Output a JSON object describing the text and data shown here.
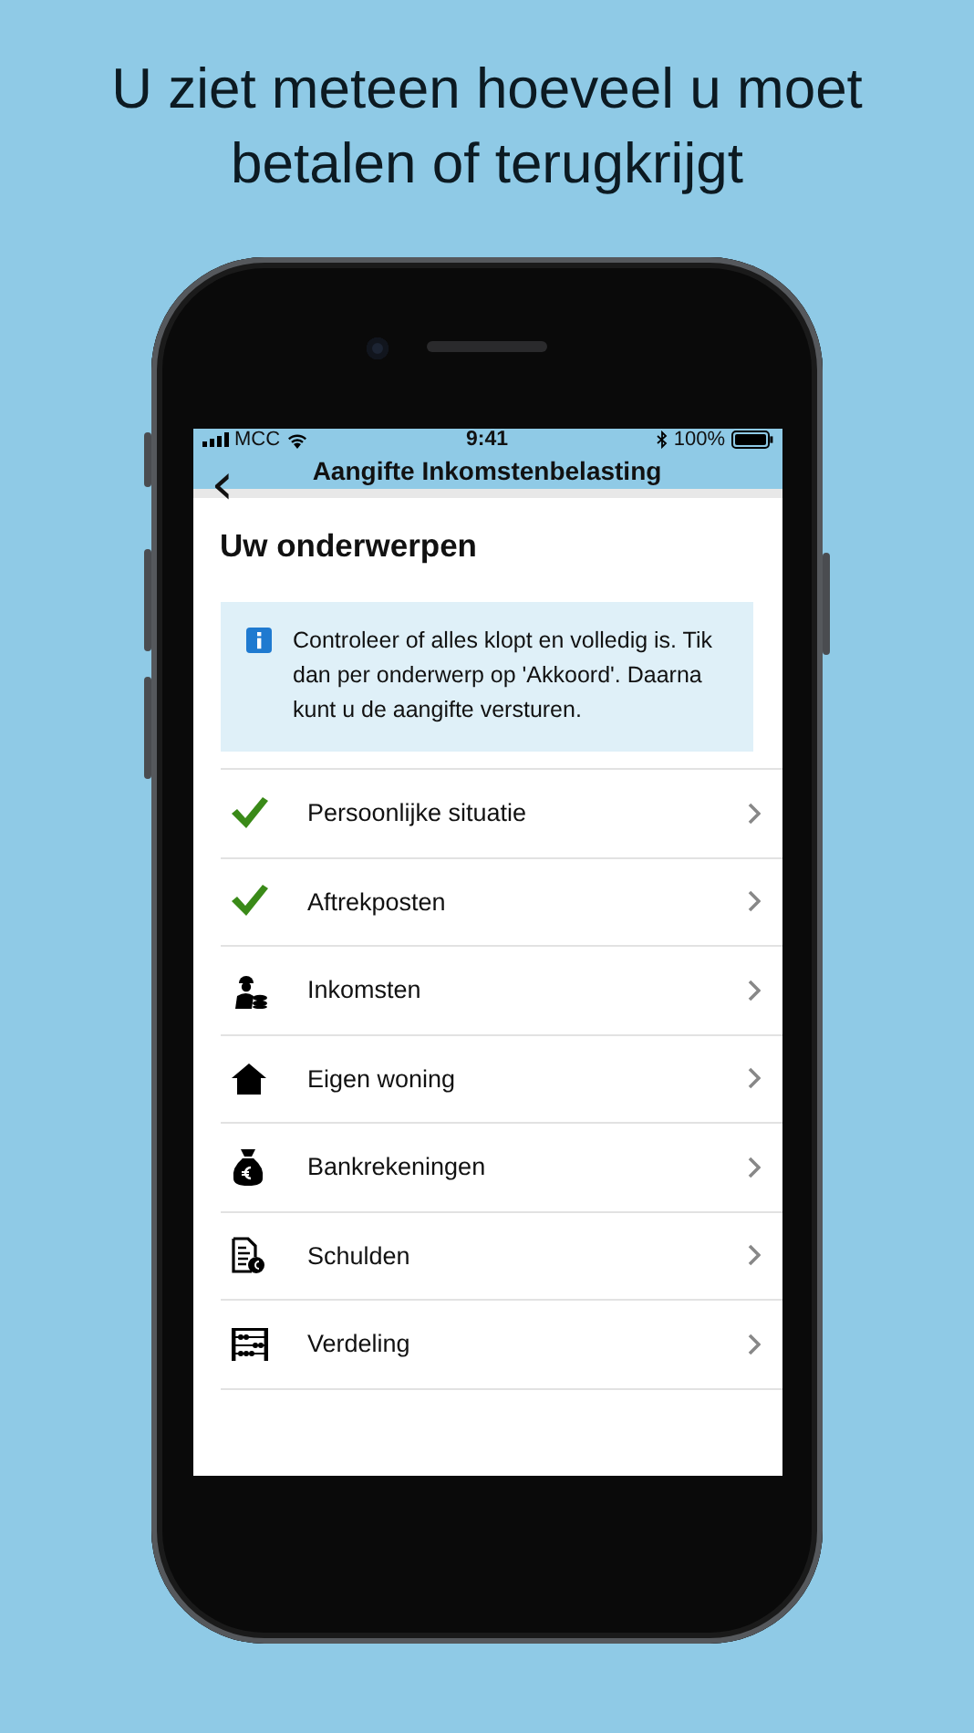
{
  "headline": "U ziet meteen hoeveel u moet betalen of terugkrijgt",
  "status_bar": {
    "carrier": "MCC",
    "time": "9:41",
    "battery": "100%"
  },
  "nav": {
    "back": "‹",
    "title": "Aangifte Inkomstenbelasting"
  },
  "section_title": "Uw onderwerpen",
  "info": "Controleer of alles klopt en volledig is. Tik dan per onderwerp op 'Akkoord'. Daarna kunt u de aangifte versturen.",
  "items": [
    {
      "kind": "check",
      "label": "Persoonlijke situatie"
    },
    {
      "kind": "check",
      "label": "Aftrekposten"
    },
    {
      "kind": "worker",
      "label": "Inkomsten"
    },
    {
      "kind": "house",
      "label": "Eigen woning"
    },
    {
      "kind": "money-bag",
      "label": "Bankrekeningen"
    },
    {
      "kind": "bill",
      "label": "Schulden"
    },
    {
      "kind": "abacus",
      "label": "Verdeling"
    }
  ]
}
